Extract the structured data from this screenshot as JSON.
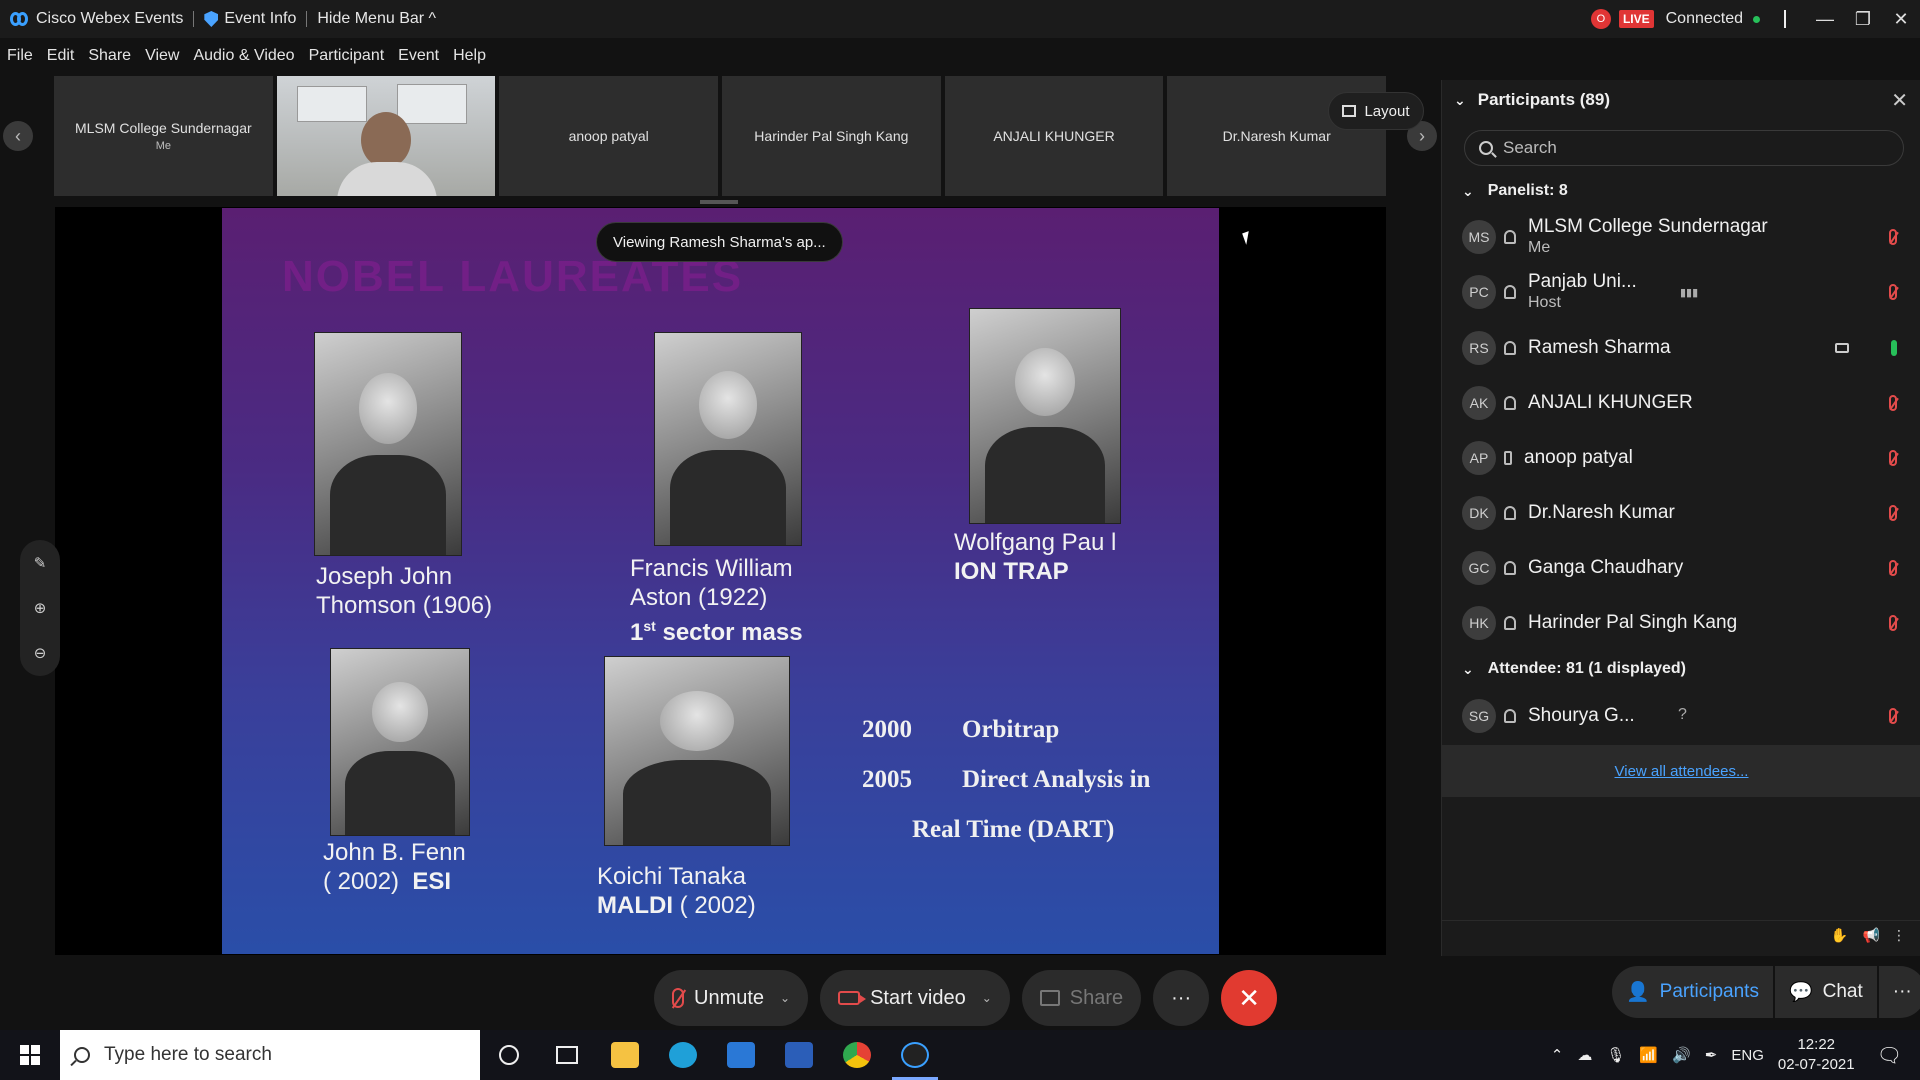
{
  "titlebar": {
    "app_name": "Cisco Webex Events",
    "event_info": "Event Info",
    "hide_menu": "Hide Menu Bar ^",
    "live": "LIVE",
    "rec": "O",
    "status": "Connected"
  },
  "menu": [
    "File",
    "Edit",
    "Share",
    "View",
    "Audio & Video",
    "Participant",
    "Event",
    "Help"
  ],
  "thumbnails": [
    {
      "name": "MLSM College Sundernagar",
      "sub": "Me"
    },
    {
      "name": "",
      "sub": "",
      "video": true
    },
    {
      "name": "anoop patyal",
      "sub": ""
    },
    {
      "name": "Harinder Pal Singh Kang",
      "sub": ""
    },
    {
      "name": "ANJALI KHUNGER",
      "sub": ""
    },
    {
      "name": "Dr.Naresh Kumar",
      "sub": ""
    }
  ],
  "layout_label": "Layout",
  "viewing_label": "Viewing Ramesh Sharma's ap...",
  "slide": {
    "title": "NOBEL LAUREATES",
    "thomson_1": "Joseph John",
    "thomson_2": "Thomson (1906)",
    "aston_1": "Francis William",
    "aston_2": "Aston  (1922)",
    "aston_3a": "1",
    "aston_3sup": "st",
    "aston_3b": " sector mass",
    "paul_1": "Wolfgang Pau l",
    "paul_2": "ION TRAP",
    "fenn_1": "John B. Fenn",
    "fenn_2a": "( 2002)  ",
    "fenn_2b": "ESI",
    "tanaka_1": "Koichi Tanaka",
    "tanaka_2a": "MALDI",
    "tanaka_2b": " ( 2002)",
    "orbi_year": "2000",
    "orbi_name": "Orbitrap",
    "dart_year": "2005",
    "dart_name": "Direct Analysis in",
    "dart_name2": "Real Time (DART)"
  },
  "controls": {
    "unmute": "Unmute",
    "start_video": "Start video",
    "share": "Share",
    "more": "···",
    "end": "✕"
  },
  "panel": {
    "title": "Participants (89)",
    "search_placeholder": "Search",
    "panelist_header": "Panelist: 8",
    "attendee_header": "Attendee: 81 (1 displayed)",
    "view_all": "View all attendees...",
    "panelists": [
      {
        "initials": "MS",
        "name": "MLSM College Sundernagar",
        "role": "Me"
      },
      {
        "initials": "PC",
        "name": "Panjab Uni...",
        "role": "Host"
      },
      {
        "initials": "RS",
        "name": "Ramesh Sharma",
        "role": ""
      },
      {
        "initials": "AK",
        "name": "ANJALI KHUNGER",
        "role": ""
      },
      {
        "initials": "AP",
        "name": "anoop patyal",
        "role": ""
      },
      {
        "initials": "DK",
        "name": "Dr.Naresh Kumar",
        "role": ""
      },
      {
        "initials": "GC",
        "name": "Ganga Chaudhary",
        "role": ""
      },
      {
        "initials": "HK",
        "name": "Harinder Pal Singh Kang",
        "role": ""
      }
    ],
    "attendees": [
      {
        "initials": "SG",
        "name": "Shourya G...",
        "role": "",
        "extra": "?"
      }
    ]
  },
  "tabs": {
    "participants": "Participants",
    "chat": "Chat",
    "more": "···"
  },
  "taskbar": {
    "search_placeholder": "Type here to search",
    "lang": "ENG",
    "time": "12:22",
    "date": "02-07-2021"
  },
  "colors": {
    "accent": "#4aa3ff",
    "muted": "#e24b4b",
    "end_call": "#e13a30",
    "live": "#e03535",
    "connected": "#27c05a"
  }
}
